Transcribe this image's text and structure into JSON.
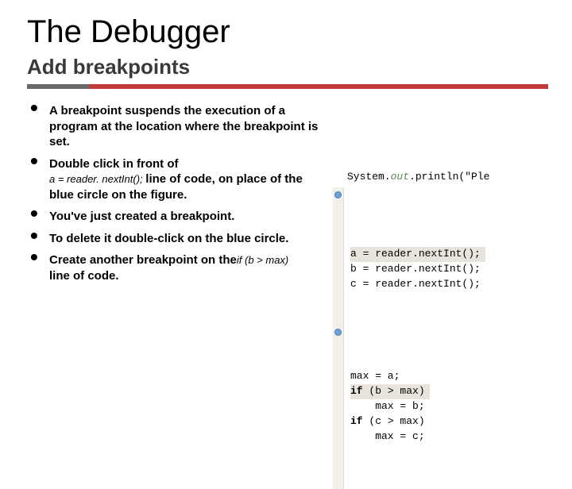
{
  "title": "The Debugger",
  "subtitle": "Add breakpoints",
  "bullets": {
    "b1": "A breakpoint suspends the execution of a program at the location where the breakpoint is set.",
    "b2a": "Double click in front of",
    "b2code": "a = reader. nextInt(); ",
    "b2b": "line of code, on place of the blue circle on the figure.",
    "b3": "You've just created a breakpoint.",
    "b4": "To delete it double-click on the blue circle.",
    "b5a": "Create another breakpoint on the",
    "b5code": "if (b > max)",
    "b5b": "line of code."
  },
  "code": {
    "println_pre": "System.",
    "println_out": "out",
    "println_post": ".println(\"Ple",
    "l1": "a = reader.nextInt();",
    "l2": "b = reader.nextInt();",
    "l3": "c = reader.nextInt();",
    "m1": "max = a;",
    "m2_if": "if",
    "m2_rest": " (b > max)",
    "m3": "    max = b;",
    "m4_if": "if",
    "m4_rest": " (c > max)",
    "m5": "    max = c;"
  }
}
